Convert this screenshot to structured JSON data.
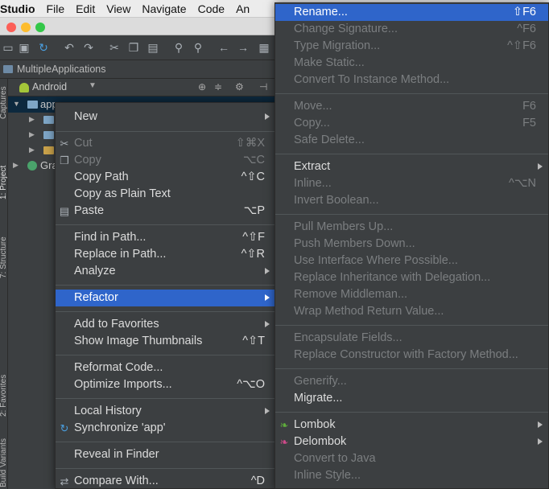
{
  "menubar": {
    "items": [
      "Studio",
      "File",
      "Edit",
      "View",
      "Navigate",
      "Code",
      "An"
    ]
  },
  "breadcrumb": {
    "label": "MultipleApplications"
  },
  "left_strip": {
    "tabs": [
      "1: Project",
      "7: Structure",
      "2: Favorites",
      "Build Variants",
      "Captures"
    ]
  },
  "project_panel": {
    "view_selector": "Android",
    "tree": [
      {
        "label": "app",
        "selected": true
      },
      {
        "label": ""
      },
      {
        "label": ""
      },
      {
        "label": ""
      },
      {
        "label": "Gra"
      }
    ]
  },
  "context_menu": {
    "items": [
      {
        "label": "New",
        "shortcut": "",
        "submenu": true,
        "disabled": false,
        "icon": ""
      },
      {
        "label": "Cut",
        "shortcut": "⇧⌘X",
        "submenu": false,
        "disabled": true,
        "icon": "scissors-icon"
      },
      {
        "label": "Copy",
        "shortcut": "⌥C",
        "submenu": false,
        "disabled": true,
        "icon": "copy-icon"
      },
      {
        "label": "Copy Path",
        "shortcut": "^⇧C",
        "submenu": false,
        "disabled": false,
        "icon": ""
      },
      {
        "label": "Copy as Plain Text",
        "shortcut": "",
        "submenu": false,
        "disabled": false,
        "icon": ""
      },
      {
        "label": "Paste",
        "shortcut": "⌥P",
        "submenu": false,
        "disabled": false,
        "icon": "paste-icon"
      },
      {
        "label": "Find in Path...",
        "shortcut": "^⇧F",
        "submenu": false,
        "disabled": false,
        "icon": ""
      },
      {
        "label": "Replace in Path...",
        "shortcut": "^⇧R",
        "submenu": false,
        "disabled": false,
        "icon": ""
      },
      {
        "label": "Analyze",
        "shortcut": "",
        "submenu": true,
        "disabled": false,
        "icon": ""
      },
      {
        "label": "Refactor",
        "shortcut": "",
        "submenu": true,
        "disabled": false,
        "icon": "",
        "highlighted": true
      },
      {
        "label": "Add to Favorites",
        "shortcut": "",
        "submenu": true,
        "disabled": false,
        "icon": ""
      },
      {
        "label": "Show Image Thumbnails",
        "shortcut": "^⇧T",
        "submenu": false,
        "disabled": false,
        "icon": ""
      },
      {
        "label": "Reformat Code...",
        "shortcut": "",
        "submenu": false,
        "disabled": false,
        "icon": ""
      },
      {
        "label": "Optimize Imports...",
        "shortcut": "^⌥O",
        "submenu": false,
        "disabled": false,
        "icon": ""
      },
      {
        "label": "Local History",
        "shortcut": "",
        "submenu": true,
        "disabled": false,
        "icon": ""
      },
      {
        "label": "Synchronize 'app'",
        "shortcut": "",
        "submenu": false,
        "disabled": false,
        "icon": "sync-icon"
      },
      {
        "label": "Reveal in Finder",
        "shortcut": "",
        "submenu": false,
        "disabled": false,
        "icon": ""
      },
      {
        "label": "Compare With...",
        "shortcut": "^D",
        "submenu": false,
        "disabled": false,
        "icon": "compare-icon"
      }
    ]
  },
  "refactor_menu": {
    "items": [
      {
        "label": "Rename...",
        "shortcut": "⇧F6",
        "submenu": false,
        "disabled": false,
        "highlighted": true
      },
      {
        "label": "Change Signature...",
        "shortcut": "^F6",
        "submenu": false,
        "disabled": true
      },
      {
        "label": "Type Migration...",
        "shortcut": "^⇧F6",
        "submenu": false,
        "disabled": true
      },
      {
        "label": "Make Static...",
        "shortcut": "",
        "submenu": false,
        "disabled": true
      },
      {
        "label": "Convert To Instance Method...",
        "shortcut": "",
        "submenu": false,
        "disabled": true
      },
      {
        "label": "Move...",
        "shortcut": "F6",
        "submenu": false,
        "disabled": true
      },
      {
        "label": "Copy...",
        "shortcut": "F5",
        "submenu": false,
        "disabled": true
      },
      {
        "label": "Safe Delete...",
        "shortcut": "",
        "submenu": false,
        "disabled": true
      },
      {
        "label": "Extract",
        "shortcut": "",
        "submenu": true,
        "disabled": false
      },
      {
        "label": "Inline...",
        "shortcut": "^⌥N",
        "submenu": false,
        "disabled": true
      },
      {
        "label": "Invert Boolean...",
        "shortcut": "",
        "submenu": false,
        "disabled": true
      },
      {
        "label": "Pull Members Up...",
        "shortcut": "",
        "submenu": false,
        "disabled": true
      },
      {
        "label": "Push Members Down...",
        "shortcut": "",
        "submenu": false,
        "disabled": true
      },
      {
        "label": "Use Interface Where Possible...",
        "shortcut": "",
        "submenu": false,
        "disabled": true
      },
      {
        "label": "Replace Inheritance with Delegation...",
        "shortcut": "",
        "submenu": false,
        "disabled": true
      },
      {
        "label": "Remove Middleman...",
        "shortcut": "",
        "submenu": false,
        "disabled": true
      },
      {
        "label": "Wrap Method Return Value...",
        "shortcut": "",
        "submenu": false,
        "disabled": true
      },
      {
        "label": "Encapsulate Fields...",
        "shortcut": "",
        "submenu": false,
        "disabled": true
      },
      {
        "label": "Replace Constructor with Factory Method...",
        "shortcut": "",
        "submenu": false,
        "disabled": true
      },
      {
        "label": "Generify...",
        "shortcut": "",
        "submenu": false,
        "disabled": true
      },
      {
        "label": "Migrate...",
        "shortcut": "",
        "submenu": false,
        "disabled": false
      },
      {
        "label": "Lombok",
        "shortcut": "",
        "submenu": true,
        "disabled": false,
        "icon": "lombok-icon"
      },
      {
        "label": "Delombok",
        "shortcut": "",
        "submenu": true,
        "disabled": false,
        "icon": "delombok-icon"
      },
      {
        "label": "Convert to Java",
        "shortcut": "",
        "submenu": false,
        "disabled": true
      },
      {
        "label": "Inline Style...",
        "shortcut": "",
        "submenu": false,
        "disabled": true
      }
    ]
  },
  "colors": {
    "menu_bg": "#3c3f41",
    "highlight": "#2f65ca",
    "text": "#dcdcdc",
    "disabled_text": "#7b7e80"
  }
}
